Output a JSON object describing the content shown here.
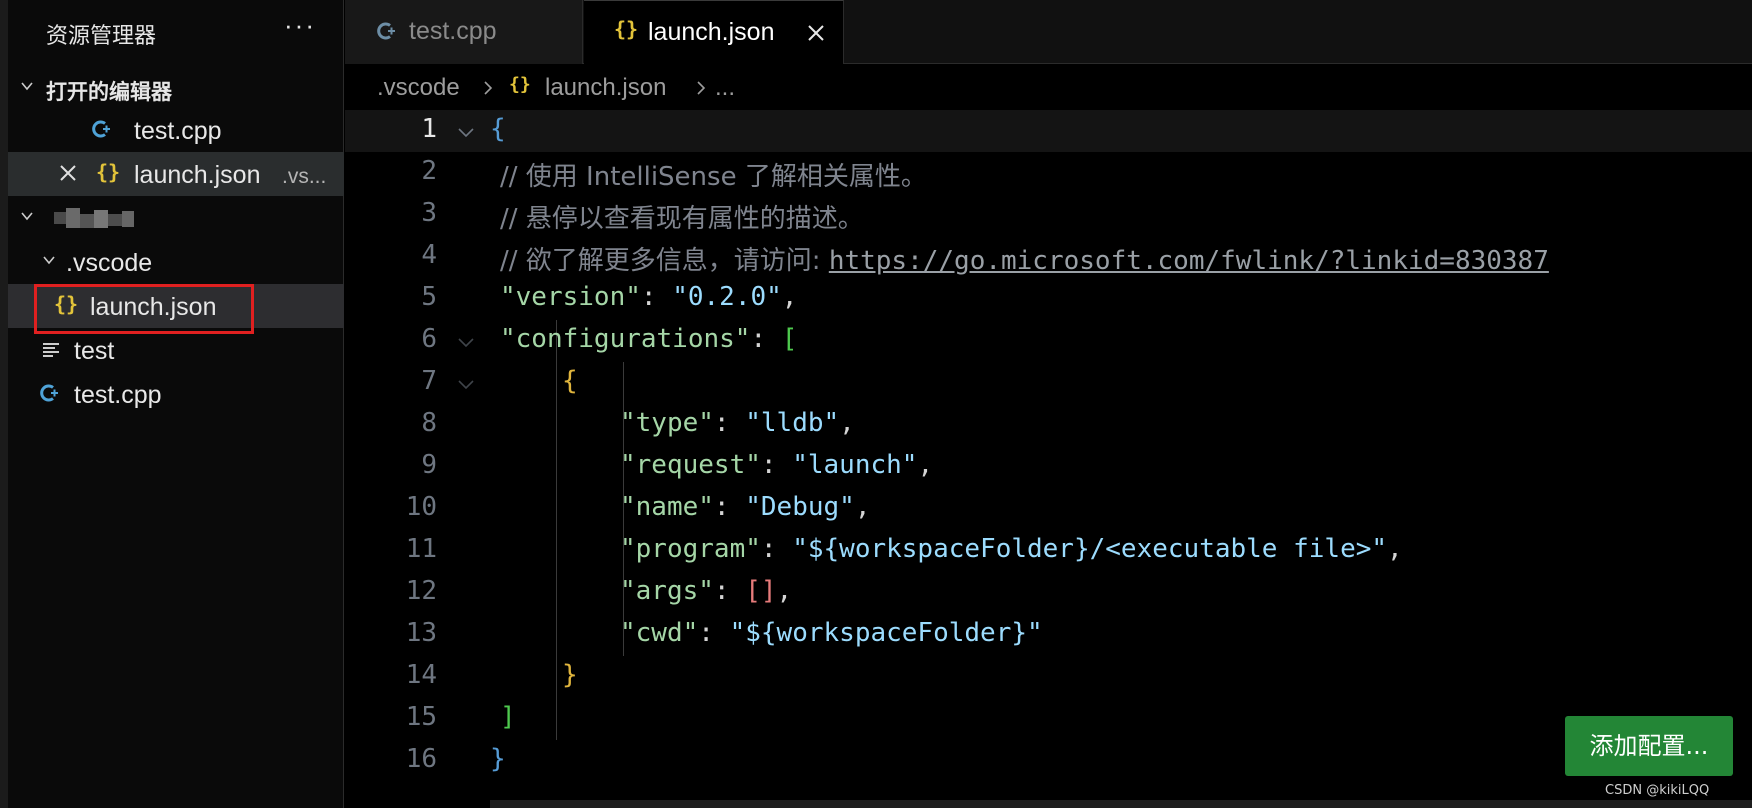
{
  "sidebar": {
    "title": "资源管理器",
    "more_label": "···",
    "open_editors_label": "打开的编辑器",
    "open_editors": [
      {
        "name": "test.cpp",
        "icon": "cpp-icon"
      },
      {
        "name": "launch.json",
        "detail": ".vs...",
        "icon": "json-icon"
      }
    ],
    "folder": {
      "name": "",
      "children": [
        {
          "name": ".vscode",
          "type": "folder"
        },
        {
          "name": "launch.json",
          "icon": "json-icon"
        },
        {
          "name": "test",
          "icon": "text-file-icon"
        },
        {
          "name": "test.cpp",
          "icon": "cpp-icon"
        }
      ]
    }
  },
  "tabs": [
    {
      "label": "test.cpp",
      "icon": "cpp-icon",
      "active": false
    },
    {
      "label": "launch.json",
      "icon": "json-icon",
      "active": true
    }
  ],
  "breadcrumb": {
    "folder": ".vscode",
    "file": "launch.json",
    "more": "..."
  },
  "editor": {
    "line_numbers": [
      "1",
      "2",
      "3",
      "4",
      "5",
      "6",
      "7",
      "8",
      "9",
      "10",
      "11",
      "12",
      "13",
      "14",
      "15",
      "16"
    ],
    "current_line": 1,
    "comment_1": "// 使用 IntelliSense 了解相关属性。",
    "comment_2": "// 悬停以查看现有属性的描述。",
    "comment_3_prefix": "// 欲了解更多信息，请访问: ",
    "comment_3_url": "https://go.microsoft.com/fwlink/?linkid=830387",
    "version_key": "\"version\"",
    "version_val": "\"0.2.0\"",
    "configurations_key": "\"configurations\"",
    "type_key": "\"type\"",
    "type_val": "\"lldb\"",
    "request_key": "\"request\"",
    "request_val": "\"launch\"",
    "name_key": "\"name\"",
    "name_val": "\"Debug\"",
    "program_key": "\"program\"",
    "program_val": "\"${workspaceFolder}/<executable file>\"",
    "args_key": "\"args\"",
    "cwd_key": "\"cwd\"",
    "cwd_val": "\"${workspaceFolder}\""
  },
  "add_config_button": "添加配置...",
  "watermark": "CSDN @kikiLQQ",
  "colors": {
    "accent_button": "#238636",
    "highlight_box": "#e02020",
    "json_icon": "#e3c43a",
    "cpp_icon": "#4fa3d8"
  }
}
